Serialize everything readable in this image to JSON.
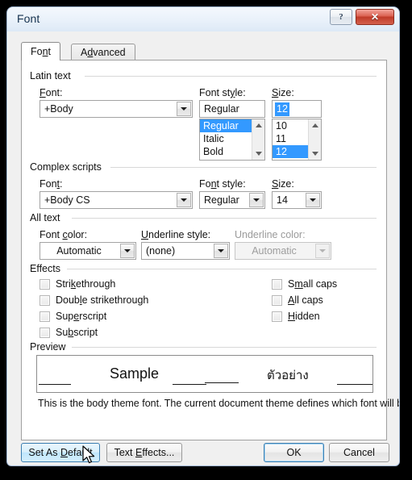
{
  "window": {
    "title": "Font",
    "help_button": "?",
    "close_button": "✕",
    "help_icon_name": "help-icon",
    "close_icon_name": "close-icon"
  },
  "tabs": [
    {
      "label": "Font",
      "active": true
    },
    {
      "label": "Advanced",
      "active": false
    }
  ],
  "groups": {
    "latin": {
      "label": "Latin text"
    },
    "complex": {
      "label": "Complex scripts"
    },
    "alltext": {
      "label": "All text"
    },
    "effects": {
      "label": "Effects"
    },
    "preview": {
      "label": "Preview"
    }
  },
  "latin": {
    "font_label": "Font:",
    "font_value": "+Body",
    "style_label": "Font style:",
    "style_value": "Regular",
    "style_options": [
      "Regular",
      "Italic",
      "Bold"
    ],
    "style_selected": "Regular",
    "size_label": "Size:",
    "size_value": "12",
    "size_options": [
      "10",
      "11",
      "12"
    ],
    "size_selected": "12"
  },
  "complex": {
    "font_label": "Font:",
    "font_value": "+Body CS",
    "style_label": "Font style:",
    "style_value": "Regular",
    "size_label": "Size:",
    "size_value": "14"
  },
  "alltext": {
    "font_color_label": "Font color:",
    "font_color_value": "Automatic",
    "underline_style_label": "Underline style:",
    "underline_style_value": "(none)",
    "underline_color_label": "Underline color:",
    "underline_color_value": "Automatic",
    "underline_color_disabled": true
  },
  "effects": {
    "left": [
      {
        "label": "Strikethrough",
        "checked": false
      },
      {
        "label": "Double strikethrough",
        "checked": false
      },
      {
        "label": "Superscript",
        "checked": false
      },
      {
        "label": "Subscript",
        "checked": false
      }
    ],
    "right": [
      {
        "label": "Small caps",
        "checked": false
      },
      {
        "label": "All caps",
        "checked": false
      },
      {
        "label": "Hidden",
        "checked": false
      }
    ]
  },
  "preview": {
    "sample_latin": "Sample",
    "sample_thai": "ตัวอย่าง",
    "note": "This is the body theme font. The current document theme defines which font will be used."
  },
  "buttons": {
    "set_as_default": "Set As Default",
    "text_effects": "Text Effects...",
    "ok": "OK",
    "cancel": "Cancel"
  },
  "colors": {
    "selection_blue": "#3399ff",
    "close_red": "#bf3a28",
    "dialog_bg": "#f0f0f0",
    "panel_bg": "#ffffff",
    "focus_border": "#3c7fb1"
  }
}
